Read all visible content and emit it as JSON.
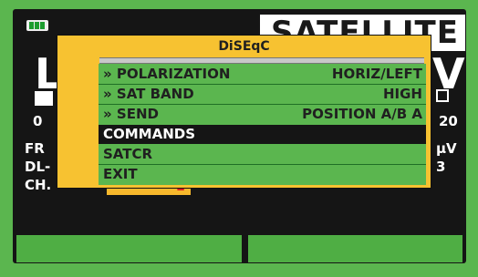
{
  "header": {
    "title": "SATELLITE",
    "battery_icon": "battery-icon"
  },
  "background": {
    "left_big": "L",
    "right_big": "V",
    "scale_start": "0",
    "scale_end": "20",
    "label_fr": "FR",
    "label_dl": "DL-",
    "label_ch": "CH.",
    "right_unit": "μV",
    "right_value": "3",
    "bar_value": "2"
  },
  "dialog": {
    "title": "DiSEqC",
    "items": [
      {
        "label": "» POLARIZATION",
        "value": "HORIZ/LEFT",
        "selected": false
      },
      {
        "label": "» SAT BAND",
        "value": "HIGH",
        "selected": false
      },
      {
        "label": "» SEND",
        "value": "POSITION A/B  A",
        "selected": false
      },
      {
        "label": "COMMANDS",
        "value": "",
        "selected": true
      },
      {
        "label": "SATCR",
        "value": "",
        "selected": false
      },
      {
        "label": "EXIT",
        "value": "",
        "selected": false
      }
    ]
  },
  "colors": {
    "frame_green": "#5bb64f",
    "dialog_yellow": "#f7c231",
    "selection_black": "#151515"
  }
}
